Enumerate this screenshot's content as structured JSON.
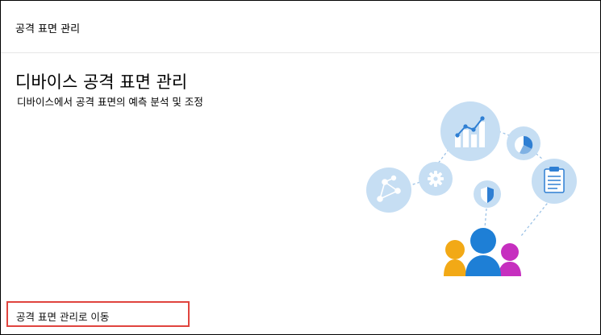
{
  "header": {
    "title": "공격 표면 관리"
  },
  "main": {
    "title": "디바이스 공격 표면 관리",
    "subtitle": "디바이스에서 공격 표면의 예측 분석 및 조정"
  },
  "footer": {
    "link_label": "공격 표면 관리로 이동"
  },
  "colors": {
    "bubble": "#c6def3",
    "icon_blue": "#2f7fd3",
    "person_blue": "#1e7fd6",
    "person_orange": "#f2a916",
    "person_magenta": "#c62fbf",
    "highlight_border": "#e0443e"
  },
  "illustration": {
    "icons": [
      "network-icon",
      "gear-icon",
      "bar-chart-icon",
      "pie-chart-icon",
      "shield-icon",
      "clipboard-icon",
      "people-icon"
    ]
  }
}
